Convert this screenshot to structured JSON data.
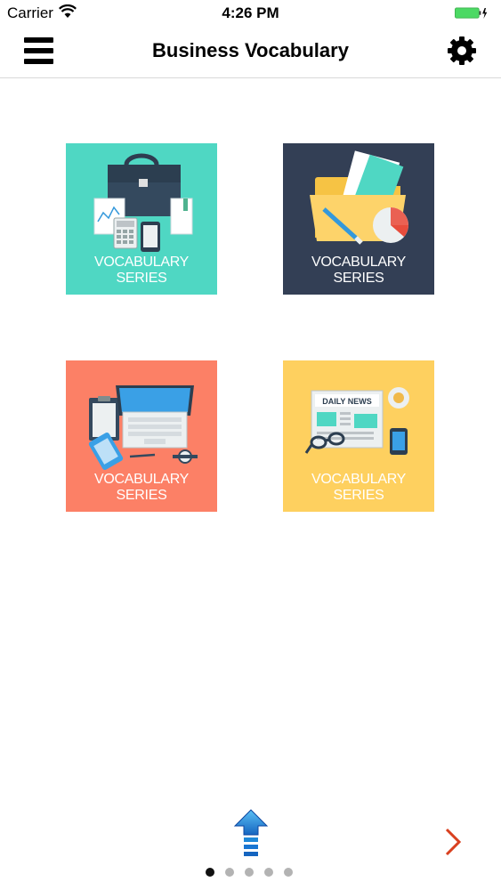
{
  "status": {
    "carrier": "Carrier",
    "time": "4:26 PM"
  },
  "header": {
    "title": "Business Vocabulary"
  },
  "tiles": [
    {
      "line1": "VOCABULARY",
      "line2": "SERIES",
      "color": "#4fd7c3"
    },
    {
      "line1": "VOCABULARY",
      "line2": "SERIES",
      "color": "#333f55"
    },
    {
      "line1": "VOCABULARY",
      "line2": "SERIES",
      "color": "#fc8066"
    },
    {
      "line1": "VOCABULARY",
      "line2": "SERIES",
      "color": "#fed05f"
    }
  ],
  "tile4_art": {
    "newspaper_heading": "DAILY NEWS"
  },
  "pager": {
    "count": 5,
    "active_index": 0
  },
  "colors": {
    "battery": "#4cd964",
    "next_arrow": "#d9401f",
    "scroll_arrow": "#1e88d8"
  }
}
